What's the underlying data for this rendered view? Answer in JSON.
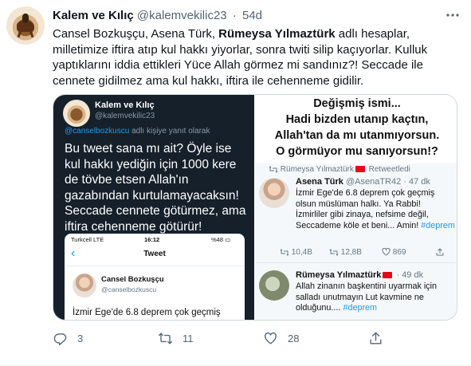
{
  "tweet": {
    "author_name": "Kalem ve Kılıç",
    "author_handle": "@kalemvekilic23",
    "dot": "·",
    "time": "54d",
    "text_part1": "Cansel Bozkuşçu, Asena Türk, ",
    "text_strong": "Rümeysa Yılmaztürk",
    "text_part2": " adlı hesaplar, milletimize iftira atıp kul hakkı yiyorlar, sonra twiti silip kaçıyorlar. Kulluk yaptıklarını iddia ettikleri Yüce Allah görmez mi sandınız?! Seccade ile cennete gidilmez ama kul hakkı, iftira ile cehenneme gidilir.",
    "icons": {
      "more": "more-horizontal-icon",
      "reply": "reply-icon",
      "retweet": "retweet-icon",
      "like": "heart-icon",
      "share": "share-icon"
    },
    "actions": {
      "replies": "3",
      "retweets": "11",
      "likes": "28"
    }
  },
  "media_left": {
    "name": "Kalem ve Kılıç",
    "handle": "@kalemvekilic23",
    "reply_mention": "@canselbozkuscu",
    "reply_rest": " adlı kişiye yanıt olarak",
    "text": "Bu tweet sana mı ait? Öyle ise kul hakkı yediğin için 1000 kere de tövbe etsen Allah'ın gazabından kurtulamayacaksın! Seccade cennete götürmez, ama iftira cehenneme götürür!",
    "phone": {
      "carrier": "Turkcell  LTE",
      "clock": "16:12",
      "battery": "%48 ▭",
      "back": "‹",
      "title": "Tweet",
      "name": "Cansel Bozkuşçu",
      "handle": "@canselbozkuscu",
      "text": "İzmir Ege'de 6.8  deprem çok geçmiş"
    }
  },
  "media_right": {
    "headline": [
      "Değişmiş ismi...",
      "Hadi bizden utanıp kaçtın,",
      "Allah'tan da mı utanmıyorsun.",
      "O görmüyor mu sanıyorsun!?"
    ],
    "retweet_label_name": "Rümeysa Yılmaztürk",
    "retweet_label_rest": " Retweetledi",
    "post1": {
      "name": "Asena Türk",
      "meta": " @AsenaTR42 · 47 dk",
      "text": "İzmir Ege'de 6.8  deprem çok geçmiş olsun müslüman halkı. Ya Rabbi! İzmirliler gibi zinaya, nefsime değil, Seccademe köle et beni... Amin!",
      "tag": "#deprem",
      "counts": {
        "retweets": "10,4B",
        "quotes": "12,8B",
        "likes": "869"
      }
    },
    "post2": {
      "name": "Rümeysa Yılmaztürk",
      "meta": " · 49 dk",
      "text": "Allah zinanın başkentini uyarmak için salladı unutmayın Lut kavmine ne olduğunu.... ",
      "tag": "#deprem"
    }
  }
}
